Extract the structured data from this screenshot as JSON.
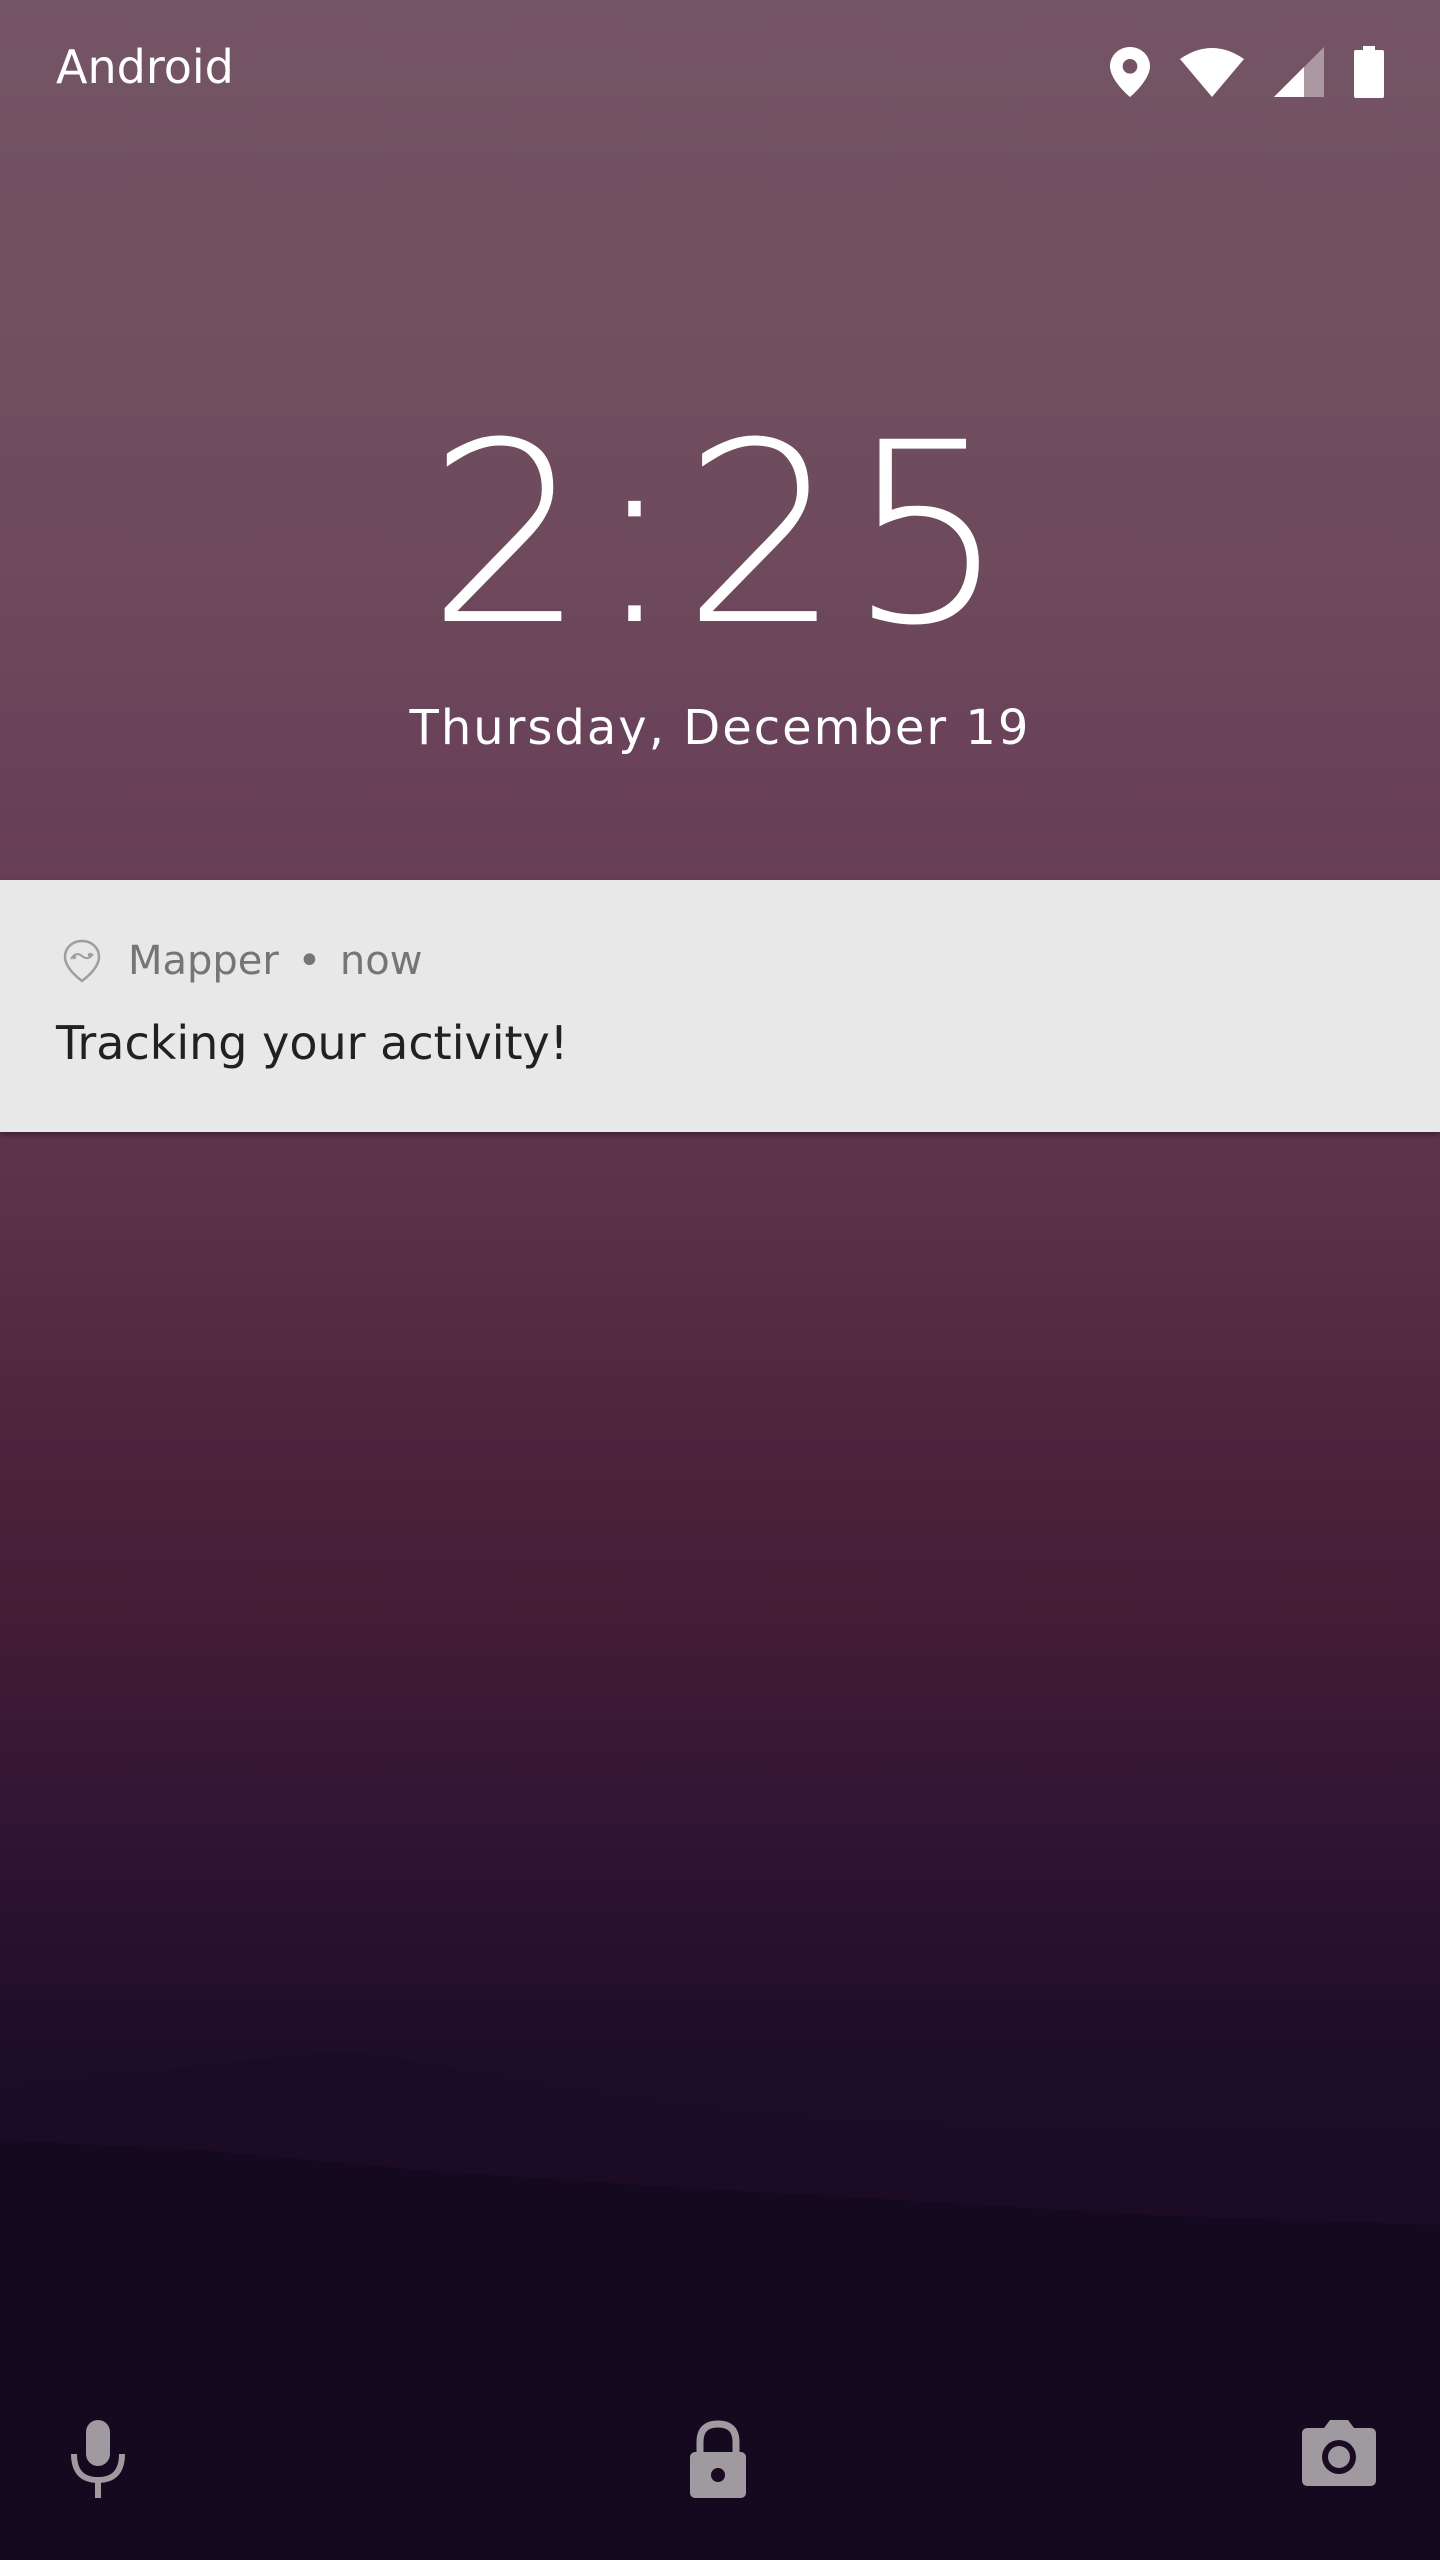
{
  "status_bar": {
    "carrier": "Android",
    "icons": [
      "location-icon",
      "wifi-icon",
      "signal-icon",
      "battery-icon"
    ]
  },
  "lockscreen": {
    "time": "2:25",
    "date": "Thursday, December 19"
  },
  "notification": {
    "app_icon": "mapper-app-icon",
    "app_name": "Mapper",
    "separator": "•",
    "timestamp": "now",
    "text": "Tracking your activity!"
  },
  "bottom_actions": {
    "left_icon": "microphone-icon",
    "center_icon": "lock-icon",
    "right_icon": "camera-icon"
  },
  "colors": {
    "notification_bg": "#e8e8e8",
    "text_primary": "#212121",
    "text_secondary": "#757575",
    "icon_muted": "#9e9aa0"
  }
}
